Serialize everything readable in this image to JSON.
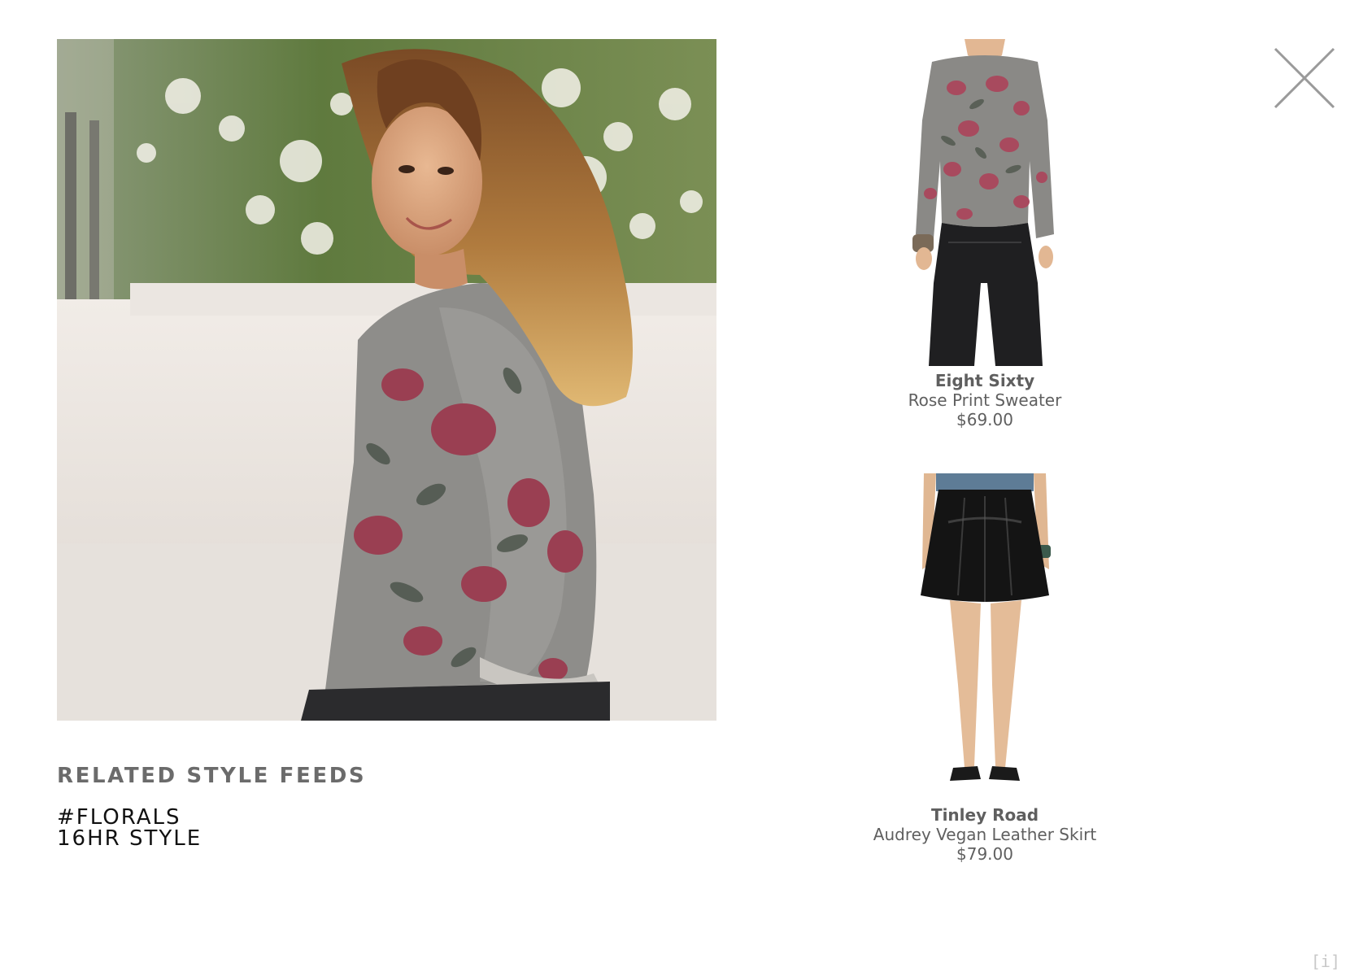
{
  "hero": {
    "alt": "Woman in rose print sweater"
  },
  "related": {
    "heading": "RELATED STYLE FEEDS",
    "feeds": [
      {
        "label": "#FLORALS"
      },
      {
        "label": "16HR STYLE"
      }
    ]
  },
  "products": [
    {
      "brand": "Eight Sixty",
      "name": "Rose Print Sweater",
      "price": "$69.00"
    },
    {
      "brand": "Tinley Road",
      "name": "Audrey Vegan Leather Skirt",
      "price": "$79.00"
    }
  ],
  "controls": {
    "close_icon": "close-icon",
    "info_label": "[i]"
  },
  "colors": {
    "background": "#ffffff",
    "heading": "#6b6b6b",
    "feed_text": "#111111",
    "product_text": "#5f5f5f",
    "close_stroke": "#9a9a9a",
    "info_text": "#c8c8c8"
  }
}
